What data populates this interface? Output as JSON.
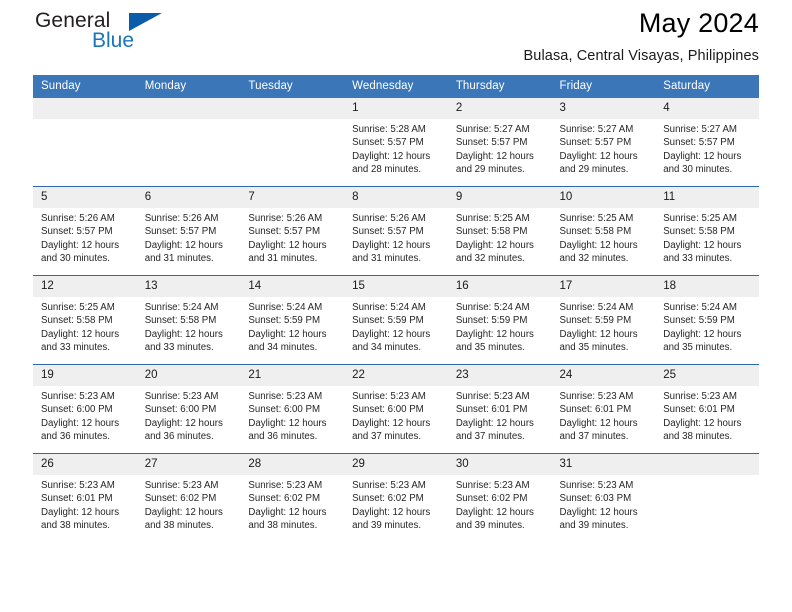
{
  "brand": {
    "name_part1": "General",
    "name_part2": "Blue"
  },
  "header": {
    "month_title": "May 2024",
    "location": "Bulasa, Central Visayas, Philippines"
  },
  "colors": {
    "header_blue": "#3a76b8",
    "row_rule_blue": "#2d6aab",
    "daynum_band": "#efefef",
    "logo_blue": "#1b75bb",
    "logo_triangle": "#0b5ca8"
  },
  "calendar": {
    "weekday_headers": [
      "Sunday",
      "Monday",
      "Tuesday",
      "Wednesday",
      "Thursday",
      "Friday",
      "Saturday"
    ],
    "weeks": [
      [
        {
          "day": "",
          "empty": true,
          "sunrise": "",
          "sunset": "",
          "daylight1": "",
          "daylight2": ""
        },
        {
          "day": "",
          "empty": true,
          "sunrise": "",
          "sunset": "",
          "daylight1": "",
          "daylight2": ""
        },
        {
          "day": "",
          "empty": true,
          "sunrise": "",
          "sunset": "",
          "daylight1": "",
          "daylight2": ""
        },
        {
          "day": "1",
          "empty": false,
          "sunrise": "Sunrise: 5:28 AM",
          "sunset": "Sunset: 5:57 PM",
          "daylight1": "Daylight: 12 hours",
          "daylight2": "and 28 minutes."
        },
        {
          "day": "2",
          "empty": false,
          "sunrise": "Sunrise: 5:27 AM",
          "sunset": "Sunset: 5:57 PM",
          "daylight1": "Daylight: 12 hours",
          "daylight2": "and 29 minutes."
        },
        {
          "day": "3",
          "empty": false,
          "sunrise": "Sunrise: 5:27 AM",
          "sunset": "Sunset: 5:57 PM",
          "daylight1": "Daylight: 12 hours",
          "daylight2": "and 29 minutes."
        },
        {
          "day": "4",
          "empty": false,
          "sunrise": "Sunrise: 5:27 AM",
          "sunset": "Sunset: 5:57 PM",
          "daylight1": "Daylight: 12 hours",
          "daylight2": "and 30 minutes."
        }
      ],
      [
        {
          "day": "5",
          "empty": false,
          "sunrise": "Sunrise: 5:26 AM",
          "sunset": "Sunset: 5:57 PM",
          "daylight1": "Daylight: 12 hours",
          "daylight2": "and 30 minutes."
        },
        {
          "day": "6",
          "empty": false,
          "sunrise": "Sunrise: 5:26 AM",
          "sunset": "Sunset: 5:57 PM",
          "daylight1": "Daylight: 12 hours",
          "daylight2": "and 31 minutes."
        },
        {
          "day": "7",
          "empty": false,
          "sunrise": "Sunrise: 5:26 AM",
          "sunset": "Sunset: 5:57 PM",
          "daylight1": "Daylight: 12 hours",
          "daylight2": "and 31 minutes."
        },
        {
          "day": "8",
          "empty": false,
          "sunrise": "Sunrise: 5:26 AM",
          "sunset": "Sunset: 5:57 PM",
          "daylight1": "Daylight: 12 hours",
          "daylight2": "and 31 minutes."
        },
        {
          "day": "9",
          "empty": false,
          "sunrise": "Sunrise: 5:25 AM",
          "sunset": "Sunset: 5:58 PM",
          "daylight1": "Daylight: 12 hours",
          "daylight2": "and 32 minutes."
        },
        {
          "day": "10",
          "empty": false,
          "sunrise": "Sunrise: 5:25 AM",
          "sunset": "Sunset: 5:58 PM",
          "daylight1": "Daylight: 12 hours",
          "daylight2": "and 32 minutes."
        },
        {
          "day": "11",
          "empty": false,
          "sunrise": "Sunrise: 5:25 AM",
          "sunset": "Sunset: 5:58 PM",
          "daylight1": "Daylight: 12 hours",
          "daylight2": "and 33 minutes."
        }
      ],
      [
        {
          "day": "12",
          "empty": false,
          "sunrise": "Sunrise: 5:25 AM",
          "sunset": "Sunset: 5:58 PM",
          "daylight1": "Daylight: 12 hours",
          "daylight2": "and 33 minutes."
        },
        {
          "day": "13",
          "empty": false,
          "sunrise": "Sunrise: 5:24 AM",
          "sunset": "Sunset: 5:58 PM",
          "daylight1": "Daylight: 12 hours",
          "daylight2": "and 33 minutes."
        },
        {
          "day": "14",
          "empty": false,
          "sunrise": "Sunrise: 5:24 AM",
          "sunset": "Sunset: 5:59 PM",
          "daylight1": "Daylight: 12 hours",
          "daylight2": "and 34 minutes."
        },
        {
          "day": "15",
          "empty": false,
          "sunrise": "Sunrise: 5:24 AM",
          "sunset": "Sunset: 5:59 PM",
          "daylight1": "Daylight: 12 hours",
          "daylight2": "and 34 minutes."
        },
        {
          "day": "16",
          "empty": false,
          "sunrise": "Sunrise: 5:24 AM",
          "sunset": "Sunset: 5:59 PM",
          "daylight1": "Daylight: 12 hours",
          "daylight2": "and 35 minutes."
        },
        {
          "day": "17",
          "empty": false,
          "sunrise": "Sunrise: 5:24 AM",
          "sunset": "Sunset: 5:59 PM",
          "daylight1": "Daylight: 12 hours",
          "daylight2": "and 35 minutes."
        },
        {
          "day": "18",
          "empty": false,
          "sunrise": "Sunrise: 5:24 AM",
          "sunset": "Sunset: 5:59 PM",
          "daylight1": "Daylight: 12 hours",
          "daylight2": "and 35 minutes."
        }
      ],
      [
        {
          "day": "19",
          "empty": false,
          "sunrise": "Sunrise: 5:23 AM",
          "sunset": "Sunset: 6:00 PM",
          "daylight1": "Daylight: 12 hours",
          "daylight2": "and 36 minutes."
        },
        {
          "day": "20",
          "empty": false,
          "sunrise": "Sunrise: 5:23 AM",
          "sunset": "Sunset: 6:00 PM",
          "daylight1": "Daylight: 12 hours",
          "daylight2": "and 36 minutes."
        },
        {
          "day": "21",
          "empty": false,
          "sunrise": "Sunrise: 5:23 AM",
          "sunset": "Sunset: 6:00 PM",
          "daylight1": "Daylight: 12 hours",
          "daylight2": "and 36 minutes."
        },
        {
          "day": "22",
          "empty": false,
          "sunrise": "Sunrise: 5:23 AM",
          "sunset": "Sunset: 6:00 PM",
          "daylight1": "Daylight: 12 hours",
          "daylight2": "and 37 minutes."
        },
        {
          "day": "23",
          "empty": false,
          "sunrise": "Sunrise: 5:23 AM",
          "sunset": "Sunset: 6:01 PM",
          "daylight1": "Daylight: 12 hours",
          "daylight2": "and 37 minutes."
        },
        {
          "day": "24",
          "empty": false,
          "sunrise": "Sunrise: 5:23 AM",
          "sunset": "Sunset: 6:01 PM",
          "daylight1": "Daylight: 12 hours",
          "daylight2": "and 37 minutes."
        },
        {
          "day": "25",
          "empty": false,
          "sunrise": "Sunrise: 5:23 AM",
          "sunset": "Sunset: 6:01 PM",
          "daylight1": "Daylight: 12 hours",
          "daylight2": "and 38 minutes."
        }
      ],
      [
        {
          "day": "26",
          "empty": false,
          "sunrise": "Sunrise: 5:23 AM",
          "sunset": "Sunset: 6:01 PM",
          "daylight1": "Daylight: 12 hours",
          "daylight2": "and 38 minutes."
        },
        {
          "day": "27",
          "empty": false,
          "sunrise": "Sunrise: 5:23 AM",
          "sunset": "Sunset: 6:02 PM",
          "daylight1": "Daylight: 12 hours",
          "daylight2": "and 38 minutes."
        },
        {
          "day": "28",
          "empty": false,
          "sunrise": "Sunrise: 5:23 AM",
          "sunset": "Sunset: 6:02 PM",
          "daylight1": "Daylight: 12 hours",
          "daylight2": "and 38 minutes."
        },
        {
          "day": "29",
          "empty": false,
          "sunrise": "Sunrise: 5:23 AM",
          "sunset": "Sunset: 6:02 PM",
          "daylight1": "Daylight: 12 hours",
          "daylight2": "and 39 minutes."
        },
        {
          "day": "30",
          "empty": false,
          "sunrise": "Sunrise: 5:23 AM",
          "sunset": "Sunset: 6:02 PM",
          "daylight1": "Daylight: 12 hours",
          "daylight2": "and 39 minutes."
        },
        {
          "day": "31",
          "empty": false,
          "sunrise": "Sunrise: 5:23 AM",
          "sunset": "Sunset: 6:03 PM",
          "daylight1": "Daylight: 12 hours",
          "daylight2": "and 39 minutes."
        },
        {
          "day": "",
          "empty": true,
          "sunrise": "",
          "sunset": "",
          "daylight1": "",
          "daylight2": ""
        }
      ]
    ]
  }
}
